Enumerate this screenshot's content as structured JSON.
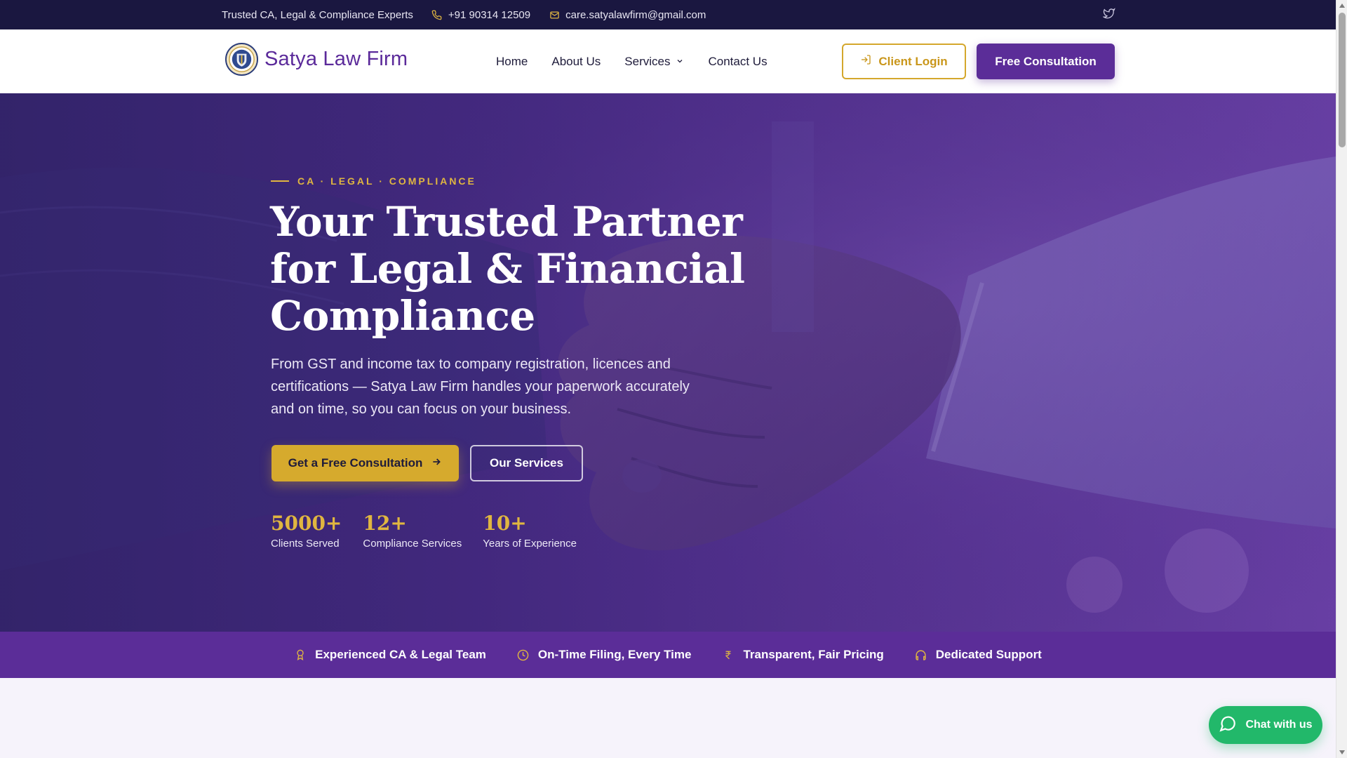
{
  "topbar": {
    "tagline": "Trusted CA, Legal & Compliance Experts",
    "phone": "+91 90314 12509",
    "email": "care.satyalawfirm@gmail.com"
  },
  "brand": {
    "name": "Satya Law Firm"
  },
  "nav": {
    "items": [
      {
        "label": "Home"
      },
      {
        "label": "About Us"
      },
      {
        "label": "Services"
      },
      {
        "label": "Contact Us"
      }
    ],
    "client_login": "Client Login",
    "free_consultation": "Free Consultation"
  },
  "hero": {
    "eyebrow": "CA · LEGAL · COMPLIANCE",
    "title": "Your Trusted Partner for Legal & Financial Compliance",
    "description": "From GST and income tax to company registration, licences and certifications — Satya Law Firm handles your paperwork accurately and on time, so you can focus on your business.",
    "primary_cta": "Get a Free Consultation",
    "secondary_cta": "Our Services",
    "stats": [
      {
        "value": "5000+",
        "label": "Clients Served"
      },
      {
        "value": "12+",
        "label": "Compliance Services"
      },
      {
        "value": "10+",
        "label": "Years of Experience"
      }
    ]
  },
  "features": [
    {
      "icon": "award-icon",
      "label": "Experienced CA & Legal Team"
    },
    {
      "icon": "clock-icon",
      "label": "On-Time Filing, Every Time"
    },
    {
      "icon": "rupee-icon",
      "label": "Transparent, Fair Pricing"
    },
    {
      "icon": "headset-icon",
      "label": "Dedicated Support"
    }
  ],
  "chat": {
    "label": "Chat with us"
  },
  "colors": {
    "topbar": "#1a1740",
    "brand_purple": "#5b2d98",
    "gold": "#d6aa2d",
    "whatsapp_green": "#22b86a"
  }
}
